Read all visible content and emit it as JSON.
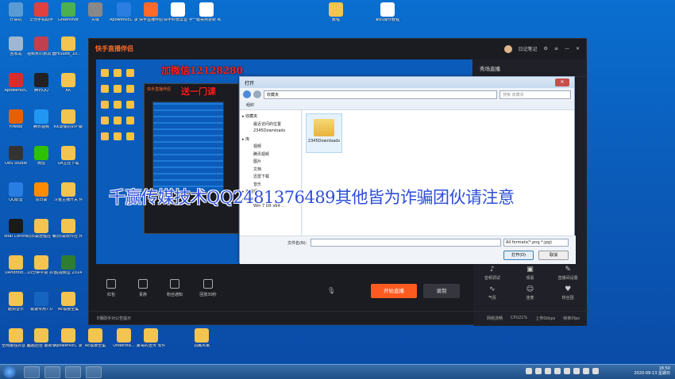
{
  "desktop_icons": [
    {
      "label": "计算机",
      "icon": "computer-icon",
      "color": "#5b9bd5"
    },
    {
      "label": "华为手机助手",
      "icon": "hisuite-icon",
      "color": "#e04040"
    },
    {
      "label": "Greenshot",
      "icon": "greenshot-icon",
      "color": "#4caf50"
    },
    {
      "label": "头像",
      "icon": "image-icon",
      "color": "#888888"
    },
    {
      "label": "ApowerREC 录屏王",
      "icon": "apowerrec-icon",
      "color": "#2a7de1"
    },
    {
      "label": "快手直播伴侣",
      "icon": "kuaishou-icon",
      "color": "#ff6a2a"
    },
    {
      "label": "快手科普屏显 手机号",
      "icon": "document-icon",
      "color": "#ffffff"
    },
    {
      "label": "一键禁用更新 和defender",
      "icon": "disable-icon",
      "color": "#ffffff"
    },
    {
      "label": "教程",
      "icon": "folder-icon",
      "color": "#f3c44f"
    },
    {
      "label": "新的操作教程",
      "icon": "document-icon",
      "color": "#ffffff"
    },
    {
      "label": "回收站",
      "icon": "recycle-bin-icon",
      "color": "#9fb7d0"
    },
    {
      "label": "视频水印添加 器",
      "icon": "video-tool-icon",
      "color": "#c04050"
    },
    {
      "label": "HiSuite_10...",
      "icon": "folder-icon",
      "color": "#f3c44f"
    },
    {
      "label": "ApowerREC",
      "icon": "record-icon",
      "color": "#d92c2c"
    },
    {
      "label": "腾讯QQ",
      "icon": "qq-icon",
      "color": "#222222"
    },
    {
      "label": "KK",
      "icon": "folder-icon",
      "color": "#f3c44f"
    },
    {
      "label": "Firefox",
      "icon": "firefox-icon",
      "color": "#e66000"
    },
    {
      "label": "腾讯视频",
      "icon": "tencent-video-icon",
      "color": "#2196f3"
    },
    {
      "label": "KK录像机VIP 破解版 V2...",
      "icon": "folder-icon",
      "color": "#f3c44f"
    },
    {
      "label": "OBS Studio",
      "icon": "obs-icon",
      "color": "#333333"
    },
    {
      "label": "微信",
      "icon": "wechat-icon",
      "color": "#2dc100"
    },
    {
      "label": "UA主控下载",
      "icon": "folder-icon",
      "color": "#f3c44f"
    },
    {
      "label": "QQ影音",
      "icon": "qq-player-icon",
      "color": "#2a7de1"
    },
    {
      "label": "向日葵",
      "icon": "sunflower-icon",
      "color": "#ff8c00"
    },
    {
      "label": "斗鱼主播开关 件",
      "icon": "folder-icon",
      "color": "#f3c44f"
    },
    {
      "label": "Total Control",
      "icon": "total-control-icon",
      "color": "#1a1a1a"
    },
    {
      "label": "向日葵远程控 制",
      "icon": "folder-icon",
      "color": "#f3c44f"
    },
    {
      "label": "向日葵软件控 件",
      "icon": "folder-icon",
      "color": "#f3c44f"
    },
    {
      "label": "UAndroid...",
      "icon": "folder-icon",
      "color": "#f3c44f"
    },
    {
      "label": "10分钟学会 抖音上热门",
      "icon": "folder-icon",
      "color": "#f3c44f"
    },
    {
      "label": "短视频营 2014",
      "icon": "video-icon",
      "color": "#2e7d32"
    },
    {
      "label": "酷狗音乐",
      "icon": "folder-icon",
      "color": "#f3c44f"
    },
    {
      "label": "极速专用7.0",
      "icon": "speed-icon",
      "color": "#1565c0"
    },
    {
      "label": "AE模板全集",
      "icon": "folder-icon",
      "color": "#f3c44f"
    },
    {
      "label": "全网最强抖音 直播课...",
      "icon": "folder-icon",
      "color": "#f3c44f"
    },
    {
      "label": "超越后台 最新软件",
      "icon": "folder-icon",
      "color": "#f3c44f"
    },
    {
      "label": "ApowerREC 录屏王",
      "icon": "folder-icon",
      "color": "#f3c44f"
    },
    {
      "label": "AE模板全集",
      "icon": "folder-icon",
      "color": "#f3c44f"
    },
    {
      "label": "Understa...",
      "icon": "folder-icon",
      "color": "#f3c44f"
    },
    {
      "label": "蒙哥的宣传 软件",
      "icon": "folder-icon",
      "color": "#f3c44f"
    },
    {
      "label": "羽翼风格",
      "icon": "folder-icon",
      "color": "#f3c44f"
    }
  ],
  "kuaishou": {
    "title": "快手直播伴侣",
    "account_name": "日记笔记",
    "sidebar_title": "秀场直播",
    "sidebar_items": [
      {
        "label": "音频调试",
        "icon": "audio-icon"
      },
      {
        "label": "观看",
        "icon": "image-icon"
      },
      {
        "label": "直播间设置",
        "icon": "brush-icon"
      },
      {
        "label": "气氛",
        "icon": "wave-icon"
      },
      {
        "label": "连麦",
        "icon": "person-icon"
      },
      {
        "label": "粉丝团",
        "icon": "fan-icon"
      }
    ],
    "tools": [
      {
        "label": "红包",
        "icon": "redpacket-icon"
      },
      {
        "label": "贵族",
        "icon": "noble-icon"
      },
      {
        "label": "粉丝通知",
        "icon": "chat-icon"
      },
      {
        "label": "回放30秒",
        "icon": "replay-icon"
      }
    ],
    "start_live": "开始直播",
    "record": "录制",
    "status_left": "E播助手对公告提示",
    "status_right": [
      "网络流畅",
      "CPU21%",
      "上传0kbps",
      "帧率0fps"
    ]
  },
  "watermarks": {
    "top1": "加微信12128280",
    "top2": "送一门课",
    "warning": "千赢传媒技术QQ2481376489其他皆为诈骗团伙请注意",
    "inner_label": "快手直播伴侣"
  },
  "dialog": {
    "title": "打开",
    "path": "收藏夹",
    "search_placeholder": "搜索 收藏夹",
    "organize": "组织",
    "tree": [
      {
        "label": "收藏夹",
        "level": 0
      },
      {
        "label": "最近访问的位置",
        "level": 1
      },
      {
        "label": "2345Downloads",
        "level": 1
      },
      {
        "label": "库",
        "level": 0
      },
      {
        "label": "视频",
        "level": 1
      },
      {
        "label": "腾讯视频",
        "level": 1
      },
      {
        "label": "图片",
        "level": 1
      },
      {
        "label": "文档",
        "level": 1
      },
      {
        "label": "迅雷下载",
        "level": 1
      },
      {
        "label": "音乐",
        "level": 1
      },
      {
        "label": "家庭组",
        "level": 0
      },
      {
        "label": "计算机",
        "level": 0
      },
      {
        "label": "Win 7 Ult x64 ...",
        "level": 1
      }
    ],
    "folder_name": "2345Downloads",
    "filename_label": "文件名(N):",
    "filetype": "All formats(*.png *.jpg)",
    "open_button": "打开(O)",
    "cancel_button": "取消"
  },
  "taskbar": {
    "time": "18:50",
    "date": "2020-09-13 星期日"
  },
  "colors": {
    "desktop_bg": "#0b5cba",
    "kuaishou_accent": "#ff5a1f",
    "warning_text": "#2d4fd8",
    "watermark_red": "#ff2020"
  }
}
